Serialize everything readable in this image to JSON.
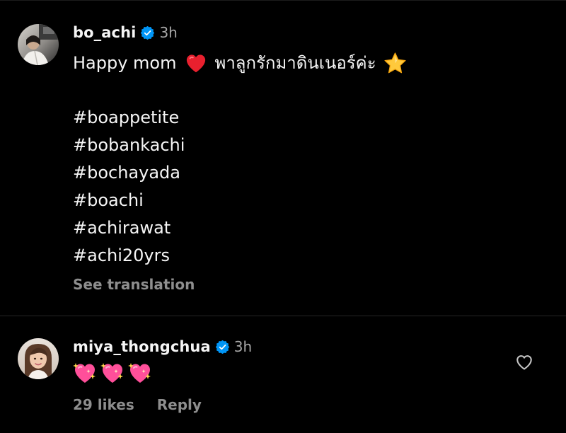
{
  "post": {
    "username": "bo_achi",
    "verified": true,
    "time": "3h",
    "caption_first_text": "Happy mom",
    "caption_first_emoji": "red-heart",
    "caption_thai": "พาลูกรักมาดินเนอร์ค่ะ",
    "caption_end_emoji": "star",
    "hashtags": [
      "#boappetite",
      "#bobankachi",
      "#bochayada",
      "#boachi",
      "#achirawat",
      "#achi20yrs"
    ],
    "see_translation": "See translation"
  },
  "comment": {
    "username": "miya_thongchua",
    "verified": true,
    "time": "3h",
    "emojis": [
      "sparkling-heart",
      "sparkling-heart",
      "sparkling-heart"
    ],
    "likes": "29 likes",
    "reply": "Reply"
  },
  "colors": {
    "background": "#000000",
    "text": "#f5f5f5",
    "secondary": "#a8a8a8",
    "muted": "#8e8e8e",
    "verified": "#0095f6",
    "divider": "#262626"
  }
}
